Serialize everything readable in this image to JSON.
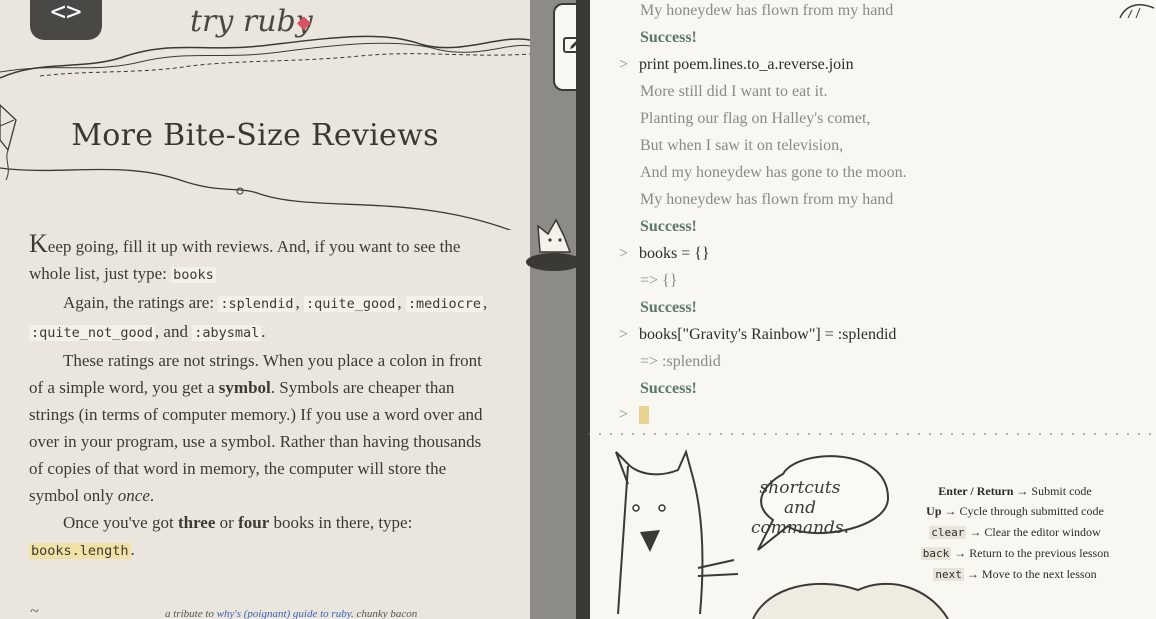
{
  "app": {
    "brand": "try ruby"
  },
  "lesson": {
    "title": "More Bite-Size Reviews",
    "p1": {
      "dropcap": "K",
      "text": "eep going, fill it up with reviews. And, if you want to see the whole list, just type: ",
      "code": "books"
    },
    "p2": {
      "text": "Again, the ratings are: ",
      "codes": [
        ":splendid",
        ":quite_good",
        ":mediocre",
        ":quite_not_good",
        ":abysmal"
      ],
      "and": ", and ",
      "sep": ", ",
      "end": "."
    },
    "p3": {
      "a": "These ratings are not strings. When you place a colon in front of a simple word, you get a ",
      "bold": "symbol",
      "b": ". Symbols are cheaper than strings (in terms of computer memory.) If you use a word over and over in your program, use a symbol. Rather than having thousands of copies of that word in memory, the computer will store the symbol only ",
      "em": "once",
      "c": "."
    },
    "p4": {
      "a": "Once you've got ",
      "bold1": "three",
      "b": " or ",
      "bold2": "four",
      "c": " books in there, type:",
      "code": "books.length",
      "end": "."
    },
    "footer": {
      "prefix": "a tribute to ",
      "link": "why's (poignant) guide to ruby",
      "suffix": ". chunky bacon"
    }
  },
  "terminal": {
    "lines": [
      {
        "kind": "out",
        "text": "My honeydew has flown from my hand"
      },
      {
        "kind": "success",
        "text": "Success!"
      },
      {
        "kind": "cmd",
        "text": "print poem.lines.to_a.reverse.join"
      },
      {
        "kind": "out",
        "text": "More still did I want to eat it."
      },
      {
        "kind": "out",
        "text": "Planting our flag on Halley's comet,"
      },
      {
        "kind": "out",
        "text": "But when I saw it on television,"
      },
      {
        "kind": "out",
        "text": "And my honeydew has gone to the moon."
      },
      {
        "kind": "out",
        "text": "My honeydew has flown from my hand"
      },
      {
        "kind": "success",
        "text": "Success!"
      },
      {
        "kind": "cmd",
        "text": "books = {}"
      },
      {
        "kind": "out",
        "text": "=> {}"
      },
      {
        "kind": "success",
        "text": "Success!"
      },
      {
        "kind": "cmd",
        "text": "books[\"Gravity's Rainbow\"] = :splendid"
      },
      {
        "kind": "out",
        "text": "=> :splendid"
      },
      {
        "kind": "success",
        "text": "Success!"
      }
    ],
    "prompt": ">",
    "input_value": ""
  },
  "help": {
    "bubble": "shortcuts and commands.",
    "items": [
      {
        "key": "Enter / Return",
        "desc": "Submit code"
      },
      {
        "key": "Up",
        "desc": "Cycle through submitted code"
      },
      {
        "key": "clear",
        "desc": "Clear the editor window"
      },
      {
        "key": "back",
        "desc": "Return to the previous lesson"
      },
      {
        "key": "next",
        "desc": "Move to the next lesson"
      }
    ],
    "arrow": "→"
  },
  "colors": {
    "success": "#5a7a67",
    "cursor": "#e6d391",
    "highlight": "#f0e2a4",
    "ruby": "#d8535f"
  }
}
